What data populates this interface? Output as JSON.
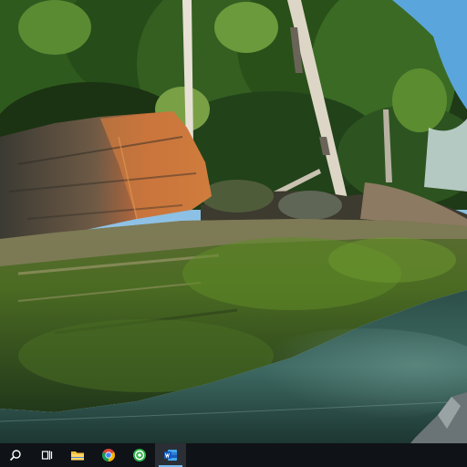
{
  "desktop": {
    "wallpaper": "lakeshore-mossy-rocks-forest"
  },
  "taskbar": {
    "accent": "#76b9ed",
    "background": "#0f1216",
    "items": [
      {
        "id": "search",
        "icon": "search-icon",
        "running": false,
        "active": false
      },
      {
        "id": "task-view",
        "icon": "task-view-icon",
        "running": false,
        "active": false
      },
      {
        "id": "file-explorer",
        "icon": "folder-icon",
        "running": false,
        "active": false
      },
      {
        "id": "chrome",
        "icon": "chrome-icon",
        "running": false,
        "active": false
      },
      {
        "id": "green-app",
        "icon": "green-app-icon",
        "running": false,
        "active": false
      },
      {
        "id": "word",
        "icon": "word-icon",
        "running": true,
        "active": true
      }
    ]
  }
}
